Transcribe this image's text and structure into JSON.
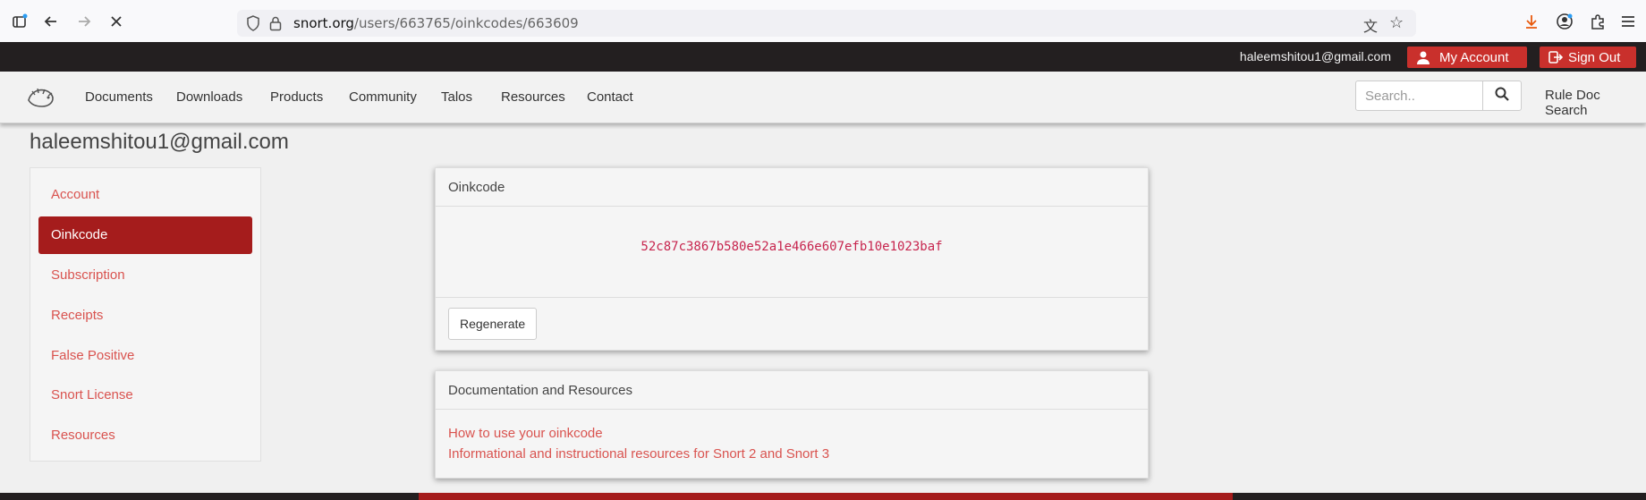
{
  "browser": {
    "url_host": "snort.org",
    "url_path": "/users/663765/oinkcodes/663609"
  },
  "topbar": {
    "email": "haleemshitou1@gmail.com",
    "my_account": "My Account",
    "sign_out": "Sign Out"
  },
  "nav": {
    "items": [
      "Documents",
      "Downloads",
      "Products",
      "Community",
      "Talos",
      "Resources",
      "Contact"
    ],
    "search_placeholder": "Search..",
    "rule_doc_search": "Rule Doc Search"
  },
  "page": {
    "title": "haleemshitou1@gmail.com"
  },
  "sidebar": {
    "items": [
      {
        "label": "Account",
        "active": false
      },
      {
        "label": "Oinkcode",
        "active": true
      },
      {
        "label": "Subscription",
        "active": false
      },
      {
        "label": "Receipts",
        "active": false
      },
      {
        "label": "False Positive",
        "active": false
      },
      {
        "label": "Snort License",
        "active": false
      },
      {
        "label": "Resources",
        "active": false
      }
    ]
  },
  "oinkcode_panel": {
    "title": "Oinkcode",
    "code": "52c87c3867b580e52a1e466e607efb10e1023baf",
    "regenerate": "Regenerate"
  },
  "docs_panel": {
    "title": "Documentation and Resources",
    "links": [
      "How to use your oinkcode",
      "Informational and instructional resources for Snort 2 and Snort 3"
    ]
  },
  "colors": {
    "accent": "#a51c1c",
    "button_red": "#c9302c",
    "link": "#d9534f",
    "topbar": "#231f20"
  }
}
